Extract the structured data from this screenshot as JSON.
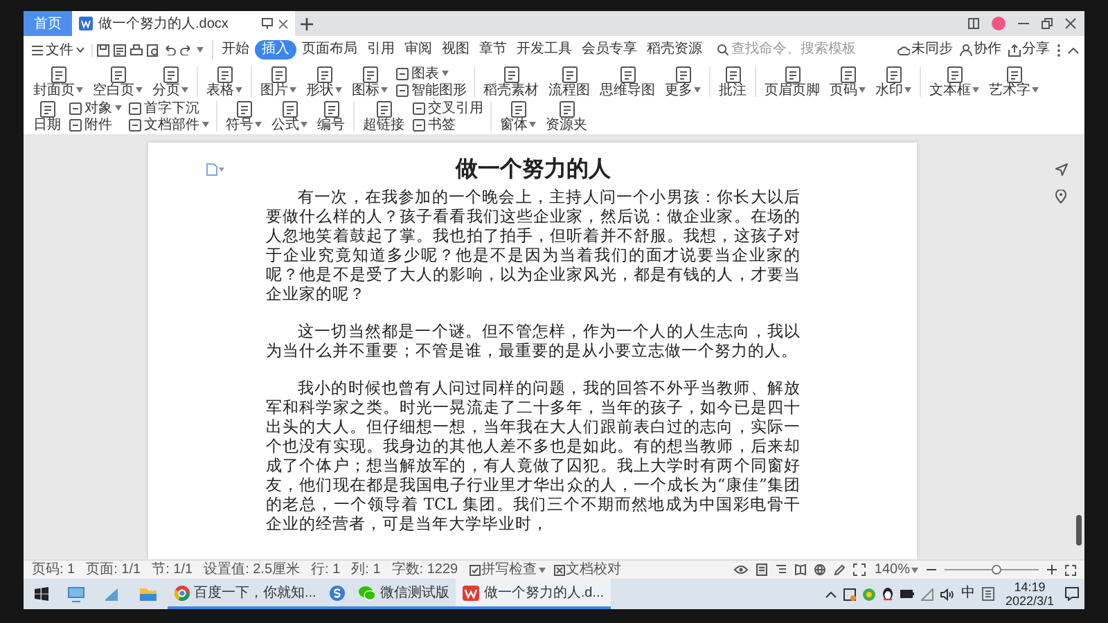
{
  "title_bar": {
    "home_tab": "首页",
    "document_tab": {
      "label": "做一个努力的人.docx"
    }
  },
  "menu_bar": {
    "file_menu": "文件",
    "tabs": [
      {
        "label": "开始",
        "selected": false
      },
      {
        "label": "插入",
        "selected": true
      },
      {
        "label": "页面布局",
        "selected": false
      },
      {
        "label": "引用",
        "selected": false
      },
      {
        "label": "审阅",
        "selected": false
      },
      {
        "label": "视图",
        "selected": false
      },
      {
        "label": "章节",
        "selected": false
      },
      {
        "label": "开发工具",
        "selected": false
      },
      {
        "label": "会员专享",
        "selected": false
      },
      {
        "label": "稻壳资源",
        "selected": false
      }
    ],
    "search": {
      "placeholder": "查找命令、搜索模板"
    },
    "actions": [
      "未同步",
      "协作",
      "分享"
    ]
  },
  "ribbon": {
    "items": [
      {
        "kind": "large",
        "label": "封面页",
        "dropdown": true
      },
      {
        "kind": "large",
        "label": "空白页",
        "dropdown": true
      },
      {
        "kind": "large",
        "label": "分页",
        "dropdown": true
      },
      {
        "kind": "divider"
      },
      {
        "kind": "large",
        "label": "表格",
        "dropdown": true
      },
      {
        "kind": "divider"
      },
      {
        "kind": "large",
        "label": "图片",
        "dropdown": true
      },
      {
        "kind": "large",
        "label": "形状",
        "dropdown": true
      },
      {
        "kind": "large",
        "label": "图标",
        "dropdown": true
      },
      {
        "kind": "stack",
        "items": [
          {
            "label": "图表",
            "dropdown": true
          },
          {
            "label": "智能图形",
            "dropdown": false
          }
        ]
      },
      {
        "kind": "divider"
      },
      {
        "kind": "large",
        "label": "稻壳素材",
        "dropdown": false
      },
      {
        "kind": "large",
        "label": "流程图",
        "dropdown": false
      },
      {
        "kind": "large",
        "label": "思维导图",
        "dropdown": false
      },
      {
        "kind": "large",
        "label": "更多",
        "dropdown": true
      },
      {
        "kind": "divider"
      },
      {
        "kind": "large",
        "label": "批注",
        "dropdown": false
      },
      {
        "kind": "divider"
      },
      {
        "kind": "large",
        "label": "页眉页脚",
        "dropdown": false
      },
      {
        "kind": "large",
        "label": "页码",
        "dropdown": true
      },
      {
        "kind": "large",
        "label": "水印",
        "dropdown": true
      },
      {
        "kind": "divider"
      },
      {
        "kind": "large",
        "label": "文本框",
        "dropdown": true
      },
      {
        "kind": "large",
        "label": "艺术字",
        "dropdown": true
      },
      {
        "kind": "large",
        "label": "日期",
        "dropdown": false
      },
      {
        "kind": "stack",
        "items": [
          {
            "label": "对象",
            "dropdown": true
          },
          {
            "label": "附件",
            "dropdown": false
          }
        ]
      },
      {
        "kind": "stack",
        "items": [
          {
            "label": "首字下沉",
            "dropdown": false
          },
          {
            "label": "文档部件",
            "dropdown": true
          }
        ]
      },
      {
        "kind": "divider"
      },
      {
        "kind": "large",
        "label": "符号",
        "dropdown": true
      },
      {
        "kind": "large",
        "label": "公式",
        "dropdown": true
      },
      {
        "kind": "large",
        "label": "编号",
        "dropdown": false
      },
      {
        "kind": "divider"
      },
      {
        "kind": "large",
        "label": "超链接",
        "dropdown": false
      },
      {
        "kind": "stack",
        "items": [
          {
            "label": "交叉引用",
            "dropdown": false
          },
          {
            "label": "书签",
            "dropdown": false
          }
        ]
      },
      {
        "kind": "divider"
      },
      {
        "kind": "large",
        "label": "窗体",
        "dropdown": true
      },
      {
        "kind": "large",
        "label": "资源夹",
        "dropdown": false
      }
    ]
  },
  "document": {
    "title": "做一个努力的人",
    "paragraphs": [
      "有一次，在我参加的一个晚会上，主持人问一个小男孩：你长大以后要做什么样的人？孩子看看我们这些企业家，然后说：做企业家。在场的人忽地笑着鼓起了掌。我也拍了拍手，但听着并不舒服。我想，这孩子对于企业究竟知道多少呢？他是不是因为当着我们的面才说要当企业家的呢？他是不是受了大人的影响，以为企业家风光，都是有钱的人，才要当企业家的呢？",
      "这一切当然都是一个谜。但不管怎样，作为一个人的人生志向，我以为当什么并不重要；不管是谁，最重要的是从小要立志做一个努力的人。",
      "我小的时候也曾有人问过同样的问题，我的回答不外乎当教师、解放军和科学家之类。时光一晃流走了二十多年，当年的孩子，如今已是四十出头的大人。但仔细想一想，当年我在大人们跟前表白过的志向，实际一个也没有实现。我身边的其他人差不多也是如此。有的想当教师，后来却成了个体户；想当解放军的，有人竟做了囚犯。我上大学时有两个同窗好友，他们现在都是我国电子行业里才华出众的人，一个成长为“康佳”集团的老总，一个领导着 TCL 集团。我们三个不期而然地成为中国彩电骨干企业的经营者，可是当年大学毕业时，"
    ]
  },
  "status_bar": {
    "fields": [
      "页码: 1",
      "页面: 1/1",
      "节: 1/1",
      "设置值: 2.5厘米",
      "行: 1",
      "列: 1",
      "字数: 1229"
    ],
    "spell_check": "拼写检查",
    "proofread": "文档校对",
    "zoom": "140%",
    "zoom_slider": {
      "level": 0.55
    }
  },
  "taskbar": {
    "apps": [
      {
        "kind": "browser",
        "label": "百度一下，你就知...",
        "selected": false
      },
      {
        "kind": "input-method",
        "selected": false
      },
      {
        "kind": "chat",
        "label": "微信测试版",
        "selected": false
      },
      {
        "kind": "writer",
        "label": "做一个努力的人.d...",
        "selected": true
      }
    ],
    "ime": "中",
    "time": "14:19",
    "date": "2022/3/1"
  }
}
